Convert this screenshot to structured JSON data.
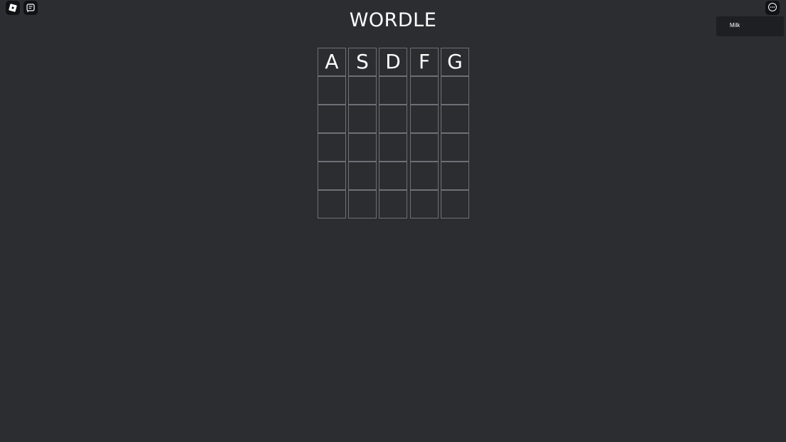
{
  "top_left_buttons": [
    {
      "icon": "roblox-logo-icon"
    },
    {
      "icon": "chat-icon"
    }
  ],
  "top_right": {
    "icon": "more-options-icon"
  },
  "player_list": [
    {
      "name": "Milk"
    }
  ],
  "game": {
    "title": "WORDLE",
    "board": [
      [
        "A",
        "S",
        "D",
        "F",
        "G"
      ],
      [
        "",
        "",
        "",
        "",
        ""
      ],
      [
        "",
        "",
        "",
        "",
        ""
      ],
      [
        "",
        "",
        "",
        "",
        ""
      ],
      [
        "",
        "",
        "",
        "",
        ""
      ],
      [
        "",
        "",
        "",
        "",
        ""
      ]
    ]
  },
  "colors": {
    "background": "#2b2d31",
    "tile_border": "#6e7077",
    "text": "#ffffff"
  }
}
